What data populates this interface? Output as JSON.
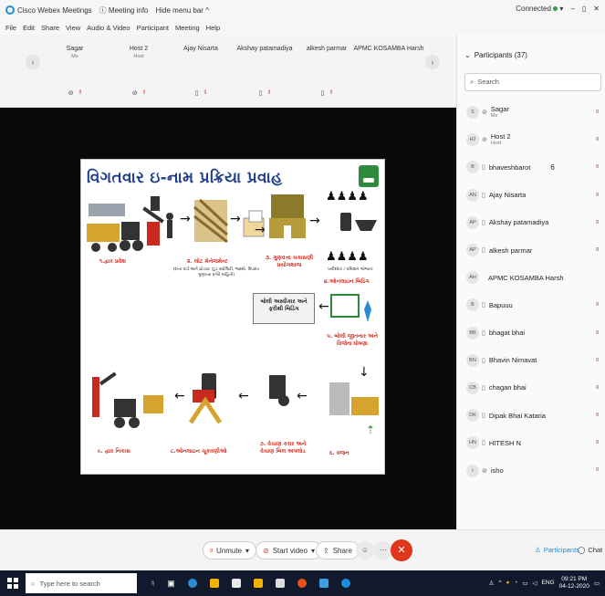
{
  "titlebar": {
    "app_name": "Cisco Webex Meetings",
    "meeting_info": "Meeting info",
    "hide_menu": "Hide menu bar ^",
    "status": "Connected",
    "min": "–",
    "restore": "▯",
    "close": "✕"
  },
  "menu": [
    "File",
    "Edit",
    "Share",
    "View",
    "Audio & Video",
    "Participant",
    "Meeting",
    "Help"
  ],
  "thumbnails": [
    {
      "name": "Sagar",
      "role": "Me"
    },
    {
      "name": "Host 2",
      "role": "Host"
    },
    {
      "name": "Ajay Nisarta",
      "role": ""
    },
    {
      "name": "Akshay patamadiya",
      "role": ""
    },
    {
      "name": "alkesh parmar",
      "role": ""
    },
    {
      "name": "APMC KOSAMBA Harsh",
      "role": ""
    }
  ],
  "slide": {
    "title": "વિગતવાર ઇ-નામ પ્રક્રિયા પ્રવાહ",
    "steps": [
      "૧.દ્વાર પ્રવેશ",
      "૨. લોટ મેનેજમેન્ટ",
      "૩. ગુણવત્તા ચકાસણી પ્રયોગશાળા",
      "૪.ઓનલાઇન બિડિંગ",
      "૫. બોલી જીતનાર અને વિજેતા ઘોષણા",
      "૬. વજન",
      "૭. વેચાણ કરાર અને વેચાણ બિલ અપલોડ",
      "૮.ઓનલાઇન ચૂકવણીઓ",
      "૯. દ્વાર નિકાસ"
    ],
    "box_label": "બોલી અસ્વીકાર અને ફરીથી બિડિંગ",
    "note_lot": "(દાંતા કાર્ડ અને પ્રોડક્ટ ઝુડ ક્વોલિટી, જથ્થો, ઉપરાંત ગુણવત્તા વગેરે માહિતી)",
    "note_bid": "ખરીદદાર / કમિશન એજન્ટ"
  },
  "panel": {
    "title": "Participants (37)",
    "search_placeholder": "Search",
    "participants": [
      {
        "initials": "S",
        "name": "Sagar",
        "role": "Me",
        "extra": ""
      },
      {
        "initials": "H2",
        "name": "Host 2",
        "role": "Host",
        "extra": ""
      },
      {
        "initials": "B",
        "name": "bhaveshbarot",
        "role": "",
        "extra": "6"
      },
      {
        "initials": "AN",
        "name": "Ajay Nisarta",
        "role": "",
        "extra": ""
      },
      {
        "initials": "AP",
        "name": "Akshay patamadiya",
        "role": "",
        "extra": ""
      },
      {
        "initials": "AP",
        "name": "alkesh parmar",
        "role": "",
        "extra": ""
      },
      {
        "initials": "AH",
        "name": "APMC KOSAMBA Harsh",
        "role": "",
        "extra": ""
      },
      {
        "initials": "B",
        "name": "Bapuuu",
        "role": "",
        "extra": ""
      },
      {
        "initials": "BB",
        "name": "bhagat bhai",
        "role": "",
        "extra": ""
      },
      {
        "initials": "BN",
        "name": "Bhavin Nimavat",
        "role": "",
        "extra": ""
      },
      {
        "initials": "CB",
        "name": "chagan bhai",
        "role": "",
        "extra": ""
      },
      {
        "initials": "DK",
        "name": "Dipak Bhai Kataria",
        "role": "",
        "extra": ""
      },
      {
        "initials": "HN",
        "name": "HITESH N",
        "role": "",
        "extra": ""
      },
      {
        "initials": "I",
        "name": "isho",
        "role": "",
        "extra": ""
      }
    ]
  },
  "controls": {
    "unmute": "Unmute",
    "start_video": "Start video",
    "share": "Share",
    "participants": "Participants",
    "chat": "Chat"
  },
  "taskbar": {
    "search_placeholder": "Type here to search",
    "lang": "ENG",
    "time": "09:21 PM",
    "date": "04-12-2020"
  },
  "colors": {
    "accent": "#1d8fd8",
    "leave": "#e0341b",
    "taskbar": "#101a2c",
    "slide_title": "#1e3d8a",
    "slide_step": "#d62d20"
  }
}
